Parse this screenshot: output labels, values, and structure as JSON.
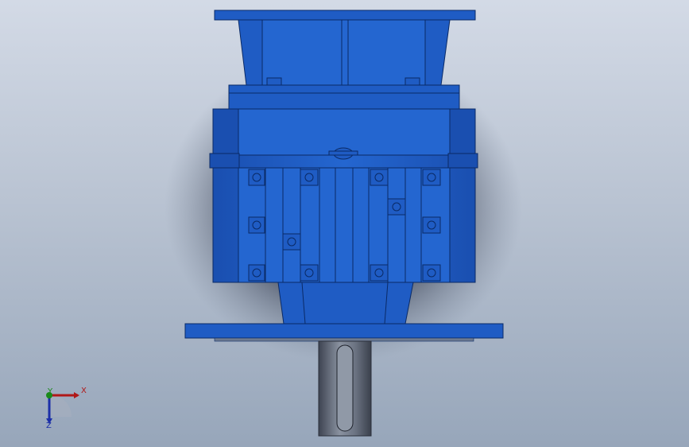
{
  "viewport": {
    "background_top": "#d3dae6",
    "background_bottom": "#97a6ba",
    "model_color": "#1f5cc4",
    "model_dark": "#0f3d8f",
    "shaft_color": "#5e6675"
  },
  "triad": {
    "x_label": "X",
    "y_label": "Y",
    "z_label": "Z",
    "x_color": "#b01818",
    "y_color": "#1a8a1a",
    "z_color": "#1c2fa8"
  }
}
